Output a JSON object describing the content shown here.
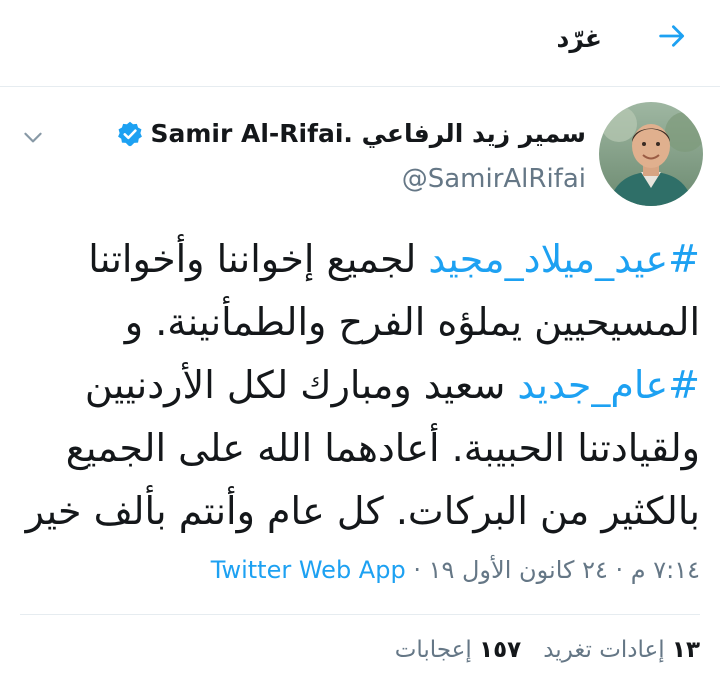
{
  "header": {
    "title": "غرّد",
    "back_icon": "arrow-right-icon"
  },
  "tweet": {
    "author_name": "سمير زيد الرفاعي .Samir Al-Rifai",
    "handle": "@SamirAlRifai",
    "verified": true,
    "menu_icon": "chevron-down-icon",
    "segments": [
      {
        "type": "hashtag",
        "text": "#عيد_ميلاد_مجيد"
      },
      {
        "type": "text",
        "text": " لجميع إخواننا وأخواتنا المسيحيين يملؤه الفرح والطمأنينة. و "
      },
      {
        "type": "hashtag",
        "text": "#عام_جديد"
      },
      {
        "type": "text",
        "text": " سعيد ومبارك لكل الأردنيين ولقيادتنا الحبيبة. أعادهما الله على الجميع بالكثير من البركات. كل عام وأنتم بألف خير"
      }
    ],
    "timestamp": "٧:١٤ م · ٢٤ كانون الأول ١٩ · ",
    "source": "Twitter Web App",
    "retweets_count": "١٣",
    "retweets_label": "إعادات تغريد",
    "likes_count": "١٥٧",
    "likes_label": "إعجابات"
  },
  "colors": {
    "accent": "#1da1f2",
    "text": "#14171a",
    "secondary": "#657786",
    "divider": "#e6ecf0"
  }
}
